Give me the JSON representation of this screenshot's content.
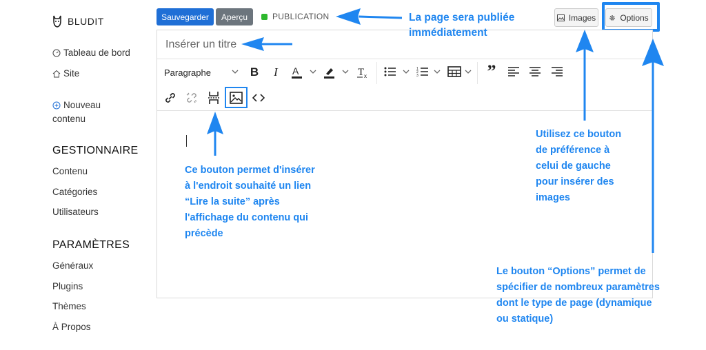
{
  "brand": {
    "name": "BLUDIT"
  },
  "sidebar": {
    "dashboard": "Tableau de bord",
    "site": "Site",
    "new_content": [
      "Nouveau",
      "contenu"
    ],
    "manager_title": "GESTIONNAIRE",
    "manager_items": [
      "Contenu",
      "Catégories",
      "Utilisateurs"
    ],
    "settings_title": "PARAMÈTRES",
    "settings_items": [
      "Généraux",
      "Plugins",
      "Thèmes",
      "À Propos"
    ]
  },
  "topbar": {
    "save_label": "Sauvegarder",
    "preview_label": "Aperçu",
    "status_label": "PUBLICATION",
    "images_label": "Images",
    "options_label": "Options"
  },
  "editor": {
    "title_placeholder": "Insérer un titre",
    "format_select": "Paragraphe"
  },
  "annotations": {
    "publish_note": [
      "La page sera publiée",
      "immédiatement"
    ],
    "images_note": [
      "Utilisez ce bouton",
      "de préférence à",
      "celui de gauche",
      "pour insérer des",
      "images"
    ],
    "readmore_note": [
      "Ce bouton permet d'insérer",
      "à l'endroit souhaité un lien",
      "“Lire la suite” après",
      "l'affichage du contenu qui",
      "précède"
    ],
    "options_note": [
      "Le bouton “Options” permet de",
      "spécifier de nombreux paramètres",
      "dont le type de page (dynamique",
      "ou statique)"
    ]
  },
  "colors": {
    "primary": "#1f6fd6",
    "annotation": "#1f86f0",
    "status_green": "#2eb82e"
  }
}
